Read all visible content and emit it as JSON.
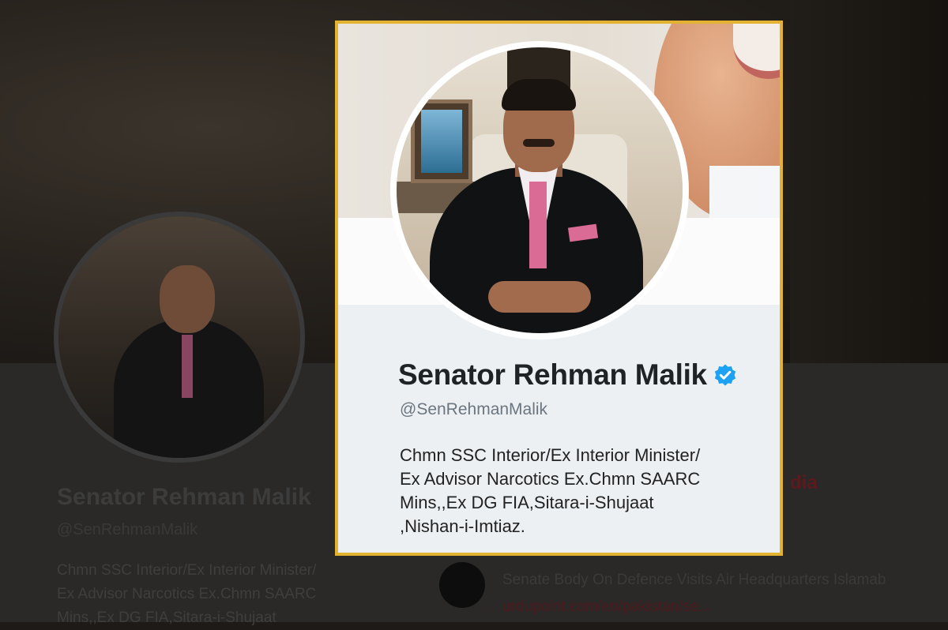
{
  "background_profile": {
    "name": "Senator Rehman Malik",
    "handle": "@SenRehmanMalik",
    "bio_lines": [
      "Chmn SSC Interior/Ex Interior Minister/",
      "Ex Advisor Narcotics Ex.Chmn SAARC",
      "Mins,,Ex DG FIA,Sitara-i-Shujaat"
    ],
    "media_label": "dia",
    "news_title": "Senate Body On Defence Visits Air Headquarters Islamab",
    "news_url": "urdupoint.com/en/pakistan/se..."
  },
  "card": {
    "name": "Senator Rehman Malik",
    "handle": "@SenRehmanMalik",
    "verified_icon": "verified-badge-icon",
    "bio_lines": [
      "Chmn SSC Interior/Ex Interior Minister/",
      "Ex Advisor Narcotics Ex.Chmn SAARC",
      "Mins,,Ex DG FIA,Sitara-i-Shujaat",
      ",Nishan-i-Imtiaz."
    ]
  },
  "colors": {
    "highlight_border": "#e3b230",
    "verified_blue": "#1da1f2",
    "news_link": "#4c1a1c"
  }
}
